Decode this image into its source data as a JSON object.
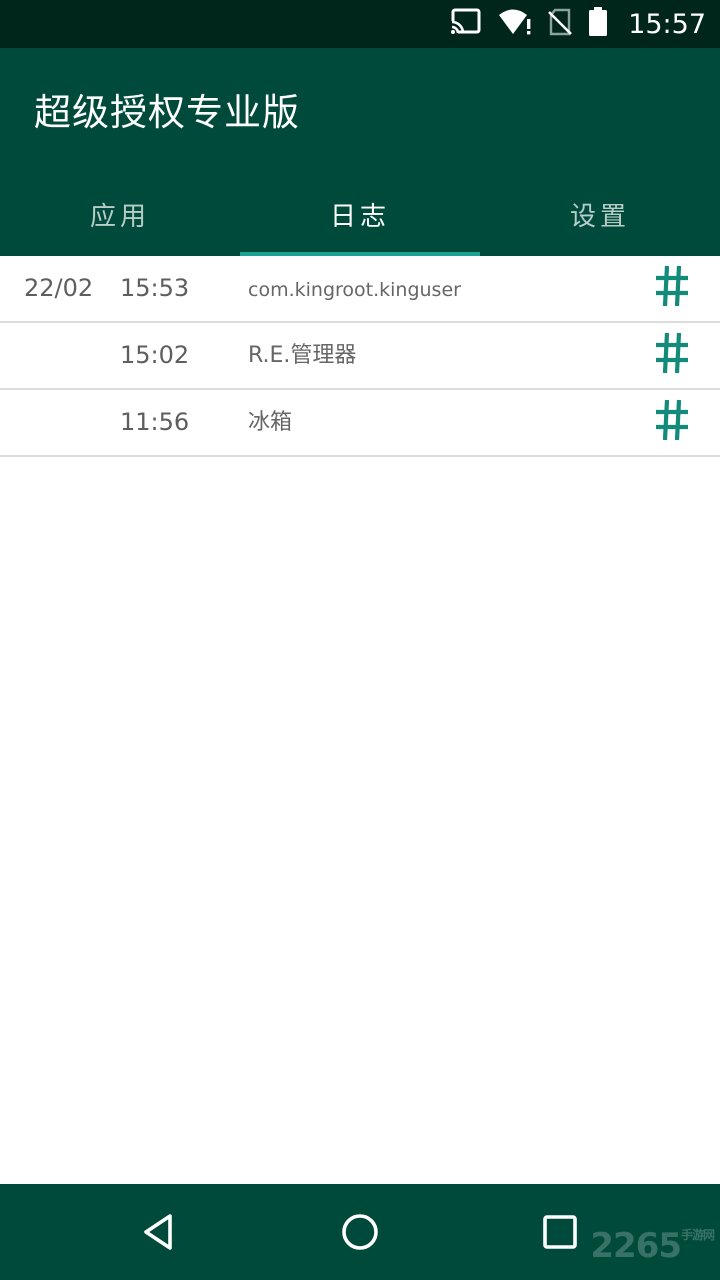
{
  "status_bar": {
    "time": "15:57",
    "icons": [
      "cast-icon",
      "wifi-alert-icon",
      "no-sim-icon",
      "battery-icon"
    ]
  },
  "app_bar": {
    "title": "超级授权专业版"
  },
  "tabs": [
    {
      "label": "应用",
      "active": false
    },
    {
      "label": "日志",
      "active": true
    },
    {
      "label": "设置",
      "active": false
    }
  ],
  "log": {
    "rows": [
      {
        "date": "22/02",
        "time": "15:53",
        "app": "com.kingroot.kinguser",
        "icon": "hash-icon"
      },
      {
        "date": "",
        "time": "15:02",
        "app": "R.E.管理器",
        "icon": "hash-icon"
      },
      {
        "date": "",
        "time": "11:56",
        "app": "冰箱",
        "icon": "hash-icon"
      }
    ]
  },
  "nav_bar": {
    "buttons": [
      "back-icon",
      "home-icon",
      "recents-icon"
    ]
  },
  "watermark": {
    "text": "2265",
    "sub": "手游网"
  },
  "colors": {
    "status_bar": "#00251b",
    "primary": "#004a3c",
    "accent": "#1aa392",
    "hash": "#138a7a"
  }
}
